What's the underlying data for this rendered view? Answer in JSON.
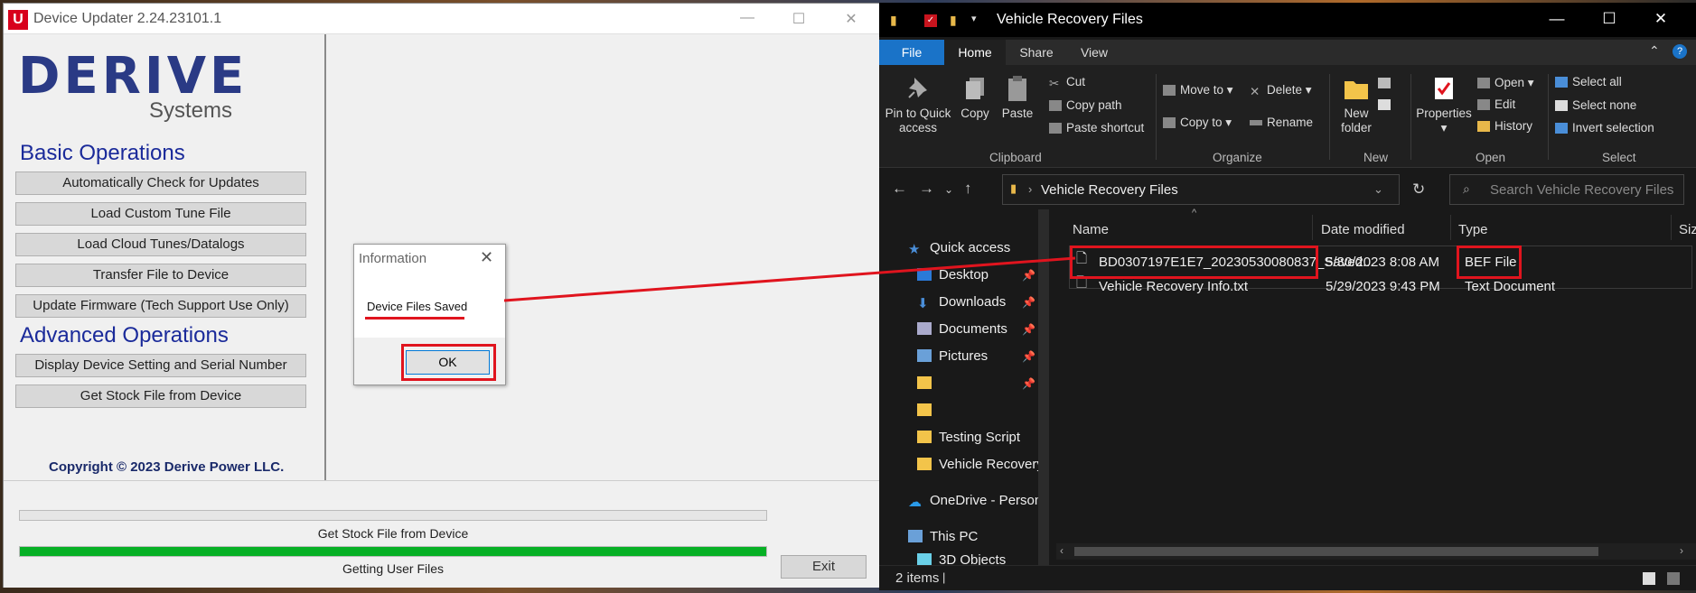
{
  "updater": {
    "title": "Device Updater 2.24.23101.1",
    "logo_glyph": "U",
    "brand": "DERIVE",
    "brand_sub": "Systems",
    "basic_heading": "Basic Operations",
    "basic_buttons": [
      "Automatically Check for Updates",
      "Load Custom Tune File",
      "Load Cloud Tunes/Datalogs",
      "Transfer File to Device",
      "Update Firmware (Tech Support Use Only)"
    ],
    "advanced_heading": "Advanced Operations",
    "advanced_buttons": [
      "Display Device Setting and Serial Number",
      "Get Stock File from Device"
    ],
    "copyright": "Copyright © 2023 Derive Power LLC.",
    "progress1_label": "Get Stock File from Device",
    "progress1_value": 0,
    "progress2_label": "Getting User Files",
    "progress2_value": 1,
    "exit_label": "Exit",
    "window_buttons": [
      "—",
      "☐",
      "✕"
    ]
  },
  "dialog": {
    "title": "Information",
    "close_glyph": "✕",
    "message": "Device Files Saved",
    "ok_label": "OK"
  },
  "explorer": {
    "title": "Vehicle Recovery Files",
    "window_buttons": [
      "—",
      "☐",
      "✕"
    ],
    "tabs": [
      "File",
      "Home",
      "Share",
      "View"
    ],
    "ribbon": {
      "pin": [
        "Pin to Quick",
        "access"
      ],
      "copy": "Copy",
      "paste": "Paste",
      "cut": "Cut",
      "copy_path": "Copy path",
      "paste_shortcut": "Paste shortcut",
      "move_to": "Move to",
      "copy_to": "Copy to",
      "delete": "Delete",
      "rename": "Rename",
      "new_folder": [
        "New",
        "folder"
      ],
      "properties": "Properties",
      "open": "Open",
      "edit": "Edit",
      "history": "History",
      "select_all": "Select all",
      "select_none": "Select none",
      "invert_selection": "Invert selection",
      "groups": [
        "Clipboard",
        "Organize",
        "New",
        "Open",
        "Select"
      ]
    },
    "address": "Vehicle Recovery Files",
    "search_placeholder": "Search Vehicle Recovery Files",
    "nav": {
      "quick_access": "Quick access",
      "desktop": "Desktop",
      "downloads": "Downloads",
      "documents": "Documents",
      "pictures": "Pictures",
      "testing_script": "Testing Script",
      "vehicle_recovery": "Vehicle Recovery",
      "onedrive": "OneDrive - Person",
      "this_pc": "This PC",
      "objects3d": "3D Objects"
    },
    "columns": [
      "Name",
      "Date modified",
      "Type",
      "Siz"
    ],
    "files": [
      {
        "name": "BD0307197E1E7_20230530080837_Saved...",
        "date": "5/30/2023 8:08 AM",
        "type": "BEF File"
      },
      {
        "name": "Vehicle Recovery Info.txt",
        "date": "5/29/2023 9:43 PM",
        "type": "Text Document"
      }
    ],
    "status": "2 items"
  },
  "colors": {
    "accent_red": "#e0141e",
    "brand_blue": "#2a3a85",
    "progress_green": "#06b025",
    "file_tab": "#1a73c8"
  }
}
